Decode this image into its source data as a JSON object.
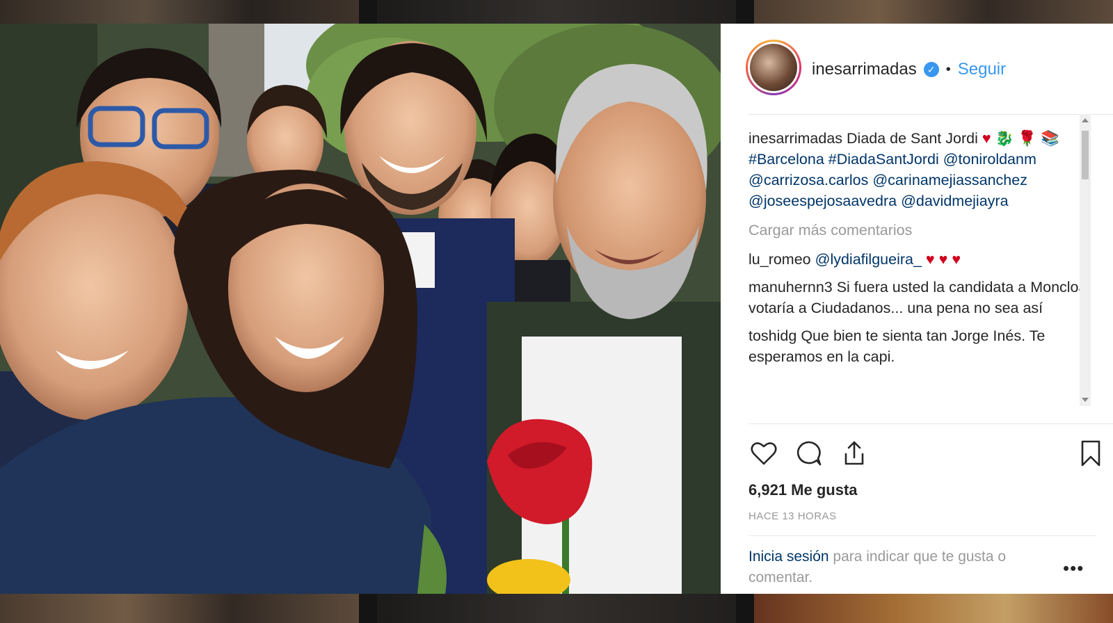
{
  "post": {
    "username": "inesarrimadas",
    "follow_label": "Seguir",
    "dot": "•",
    "verified_mark": "✓",
    "caption": {
      "username": "inesarrimadas",
      "text": "Diada de Sant Jordi",
      "hashtags": [
        "#Barcelona",
        "#DiadaSantJordi"
      ],
      "mentions": [
        "@toniroldanm",
        "@carrizosa.carlos",
        "@carinamejiassanchez",
        "@joseespejosaavedra",
        "@davidmejiayra"
      ]
    },
    "load_more_label": "Cargar más comentarios",
    "comments": [
      {
        "username": "lu_romeo",
        "mention": "@lydiafilgueira_",
        "text": "♥ ♥ ♥"
      },
      {
        "username": "manuhernn3",
        "text": "Si fuera usted la candidata a Moncloa votaría a Ciudadanos... una pena no sea así"
      },
      {
        "username": "toshidg",
        "text": "Que bien te sienta tan Jorge Inés. Te esperamos en la capi."
      }
    ],
    "likes_text": "6,921 Me gusta",
    "time_text": "HACE 13 HORAS",
    "login": {
      "link": "Inicia sesión",
      "rest": "para indicar que te gusta o comentar."
    },
    "more_label": "•••"
  },
  "colors": {
    "link_blue": "#3897f0",
    "mention_blue": "#003569",
    "text": "#262626",
    "muted": "#999999",
    "heart_red": "#d1001c"
  },
  "icons": [
    "heart-icon",
    "comment-icon",
    "share-icon",
    "bookmark-icon",
    "verified-icon",
    "rose-emoji",
    "dragon-emoji",
    "book-emoji"
  ]
}
